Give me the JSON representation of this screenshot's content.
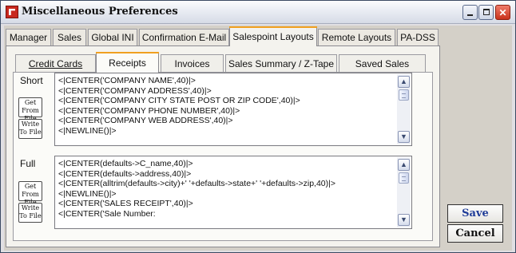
{
  "window": {
    "title": "Miscellaneous Preferences",
    "controls": {
      "minimize": "_",
      "close": "✕"
    }
  },
  "tabs": [
    {
      "label": "Manager",
      "active": false
    },
    {
      "label": "Sales",
      "active": false
    },
    {
      "label": "Global INI",
      "active": false
    },
    {
      "label": "Confirmation E-Mail",
      "active": false
    },
    {
      "label": "Salespoint Layouts",
      "active": true
    },
    {
      "label": "Remote Layouts",
      "active": false
    },
    {
      "label": "PA-DSS",
      "active": false
    }
  ],
  "subtabs": [
    {
      "label": "Credit Cards",
      "active": false
    },
    {
      "label": "Receipts",
      "active": true
    },
    {
      "label": "Invoices",
      "active": false
    },
    {
      "label": "Sales Summary / Z-Tape",
      "active": false
    },
    {
      "label": "Saved Sales",
      "active": false
    }
  ],
  "short_section": {
    "label": "Short",
    "get_from_file": "Get From File",
    "write_to_file": "Write To File",
    "lines": [
      "<|CENTER('COMPANY NAME',40)|>",
      "<|CENTER('COMPANY ADDRESS',40)|>",
      "<|CENTER('COMPANY CITY STATE POST OR ZIP CODE',40)|>",
      "<|CENTER('COMPANY PHONE NUMBER',40)|>",
      "<|CENTER('COMPANY WEB ADDRESS',40)|>",
      "<|NEWLINE()|>"
    ]
  },
  "full_section": {
    "label": "Full",
    "get_from_file": "Get From File",
    "write_to_file": "Write To File",
    "lines": [
      "<|CENTER(defaults->C_name,40)|>",
      "<|CENTER(defaults->address,40)|>",
      "<|CENTER(alltrim(defaults->city)+'  '+defaults->state+'  '+defaults->zip,40)|>",
      "<|NEWLINE()|>",
      "<|CENTER('SALES RECEIPT',40)|>",
      "<|CENTER('Sale Number:"
    ]
  },
  "scroll": {
    "up": "▲",
    "down": "▼"
  },
  "actions": {
    "save": "Save",
    "cancel": "Cancel"
  },
  "colors": {
    "active_tab_accent": "#f0a020",
    "save_text": "#1f3c98",
    "close_button": "#c9321c"
  }
}
